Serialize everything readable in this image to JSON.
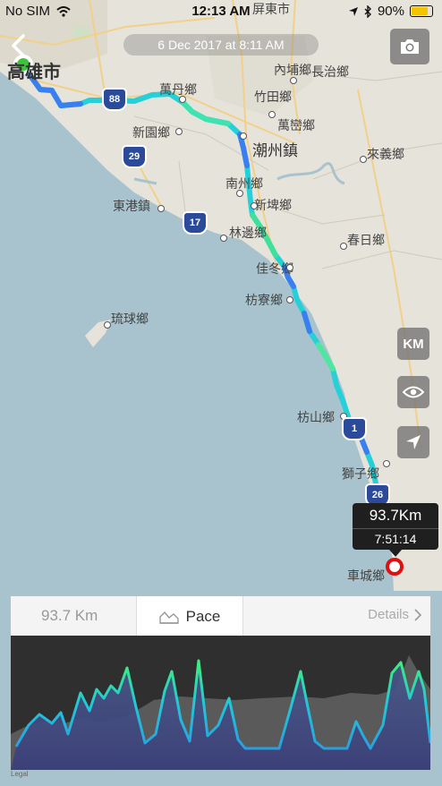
{
  "status_bar": {
    "carrier": "No SIM",
    "time": "12:13 AM",
    "battery": "90%",
    "battery_level": 0.9
  },
  "trip": {
    "date_label": "6 Dec 2017 at 8:11 AM",
    "distance": "93.7Km",
    "duration": "7:51:14"
  },
  "map": {
    "places": [
      "高雄市",
      "萬丹鄉",
      "新園鄉",
      "東港鎮",
      "南州鄉",
      "新埤鄉",
      "林邊鄉",
      "佳冬鄉",
      "枋寮鄉",
      "琉球鄉",
      "枋山鄉",
      "獅子鄉",
      "車城鄉",
      "潮州鎮",
      "竹田鄉",
      "萬巒鄉",
      "內埔鄉",
      "來義鄉",
      "春日鄉",
      "長治鄉",
      "屏東市"
    ],
    "highway_shields": [
      "88",
      "29",
      "17",
      "1",
      "26"
    ]
  },
  "controls": {
    "back_icon": "back-chevron-icon",
    "camera_icon": "camera-icon",
    "km_toggle": "KM",
    "eye_icon": "eye-icon",
    "locate_icon": "navigation-arrow-icon"
  },
  "panel": {
    "tab_distance": "93.7 Km",
    "tab_pace": "Pace",
    "tab_details": "Details"
  },
  "colors": {
    "route_start": "#1ec8d8",
    "route_blue": "#3a7ff0",
    "route_green": "#3fe0a0",
    "start_marker": "#3cc53c",
    "end_marker": "#e01010",
    "chart_bg": "#2f2f2f"
  },
  "footer": {
    "credit": "Legal"
  }
}
